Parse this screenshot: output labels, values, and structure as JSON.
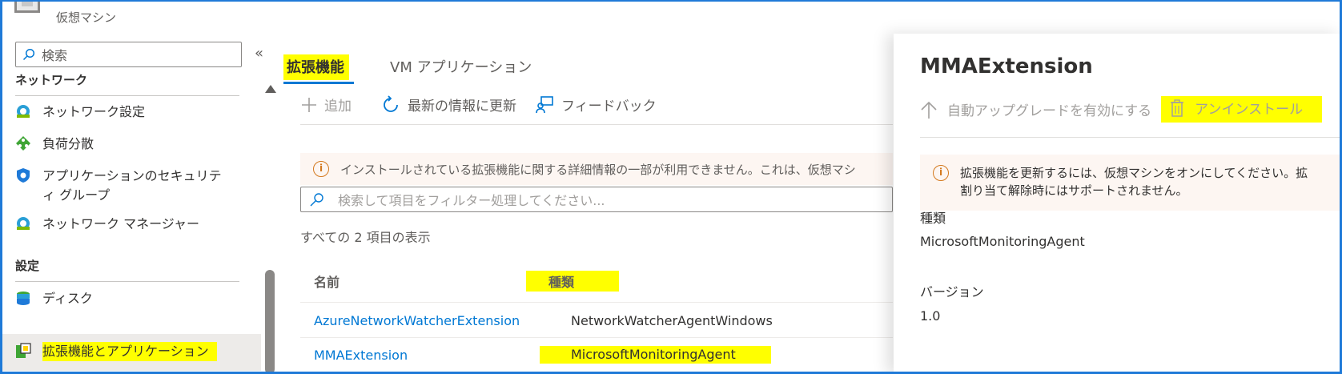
{
  "header": {
    "subtitle": "仮想マシン"
  },
  "sidebar": {
    "search_label": "検索",
    "collapse_glyph": "«",
    "sections": [
      {
        "title": "ネットワーク",
        "items": [
          {
            "label": "ネットワーク設定",
            "icon": "network-interface-icon"
          },
          {
            "label": "負荷分散",
            "icon": "load-balancer-icon"
          },
          {
            "label": "アプリケーションのセキュリティ グループ",
            "icon": "security-group-shield-icon"
          },
          {
            "label": "ネットワーク マネージャー",
            "icon": "network-manager-icon"
          }
        ]
      },
      {
        "title": "設定",
        "items": [
          {
            "label": "ディスク",
            "icon": "disk-icon"
          },
          {
            "label": "拡張機能とアプリケーション",
            "icon": "extensions-icon",
            "selected": true
          }
        ]
      }
    ]
  },
  "main": {
    "tabs": [
      {
        "label": "拡張機能",
        "active": true
      },
      {
        "label": "VM アプリケーション",
        "active": false
      }
    ],
    "toolbar": {
      "add": "追加",
      "refresh": "最新の情報に更新",
      "feedback": "フィードバック"
    },
    "info_message": "インストールされている拡張機能に関する詳細情報の一部が利用できません。これは、仮想マシ",
    "filter_placeholder": "検索して項目をフィルター処理してください...",
    "count_text": "すべての 2 項目の表示",
    "table": {
      "headers": [
        "名前",
        "種類"
      ],
      "rows": [
        {
          "name": "AzureNetworkWatcherExtension",
          "type": "NetworkWatcherAgentWindows"
        },
        {
          "name": "MMAExtension",
          "type": "MicrosoftMonitoringAgent"
        }
      ]
    }
  },
  "panel": {
    "title": "MMAExtension",
    "toolbar": {
      "enable_upgrade": "自動アップグレードを有効にする",
      "uninstall": "アンインストール"
    },
    "info_line1": "拡張機能を更新するには、仮想マシンをオンにしてください。拡",
    "info_line2": "割り当て解除時にはサポートされません。",
    "fields": [
      {
        "label": "種類",
        "value": "MicrosoftMonitoringAgent"
      },
      {
        "label": "バージョン",
        "value": "1.0"
      }
    ]
  },
  "colors": {
    "accent": "#0078d4",
    "highlight": "#ffff00",
    "warning": "#d47a1f",
    "frame": "#1f7ad8"
  }
}
